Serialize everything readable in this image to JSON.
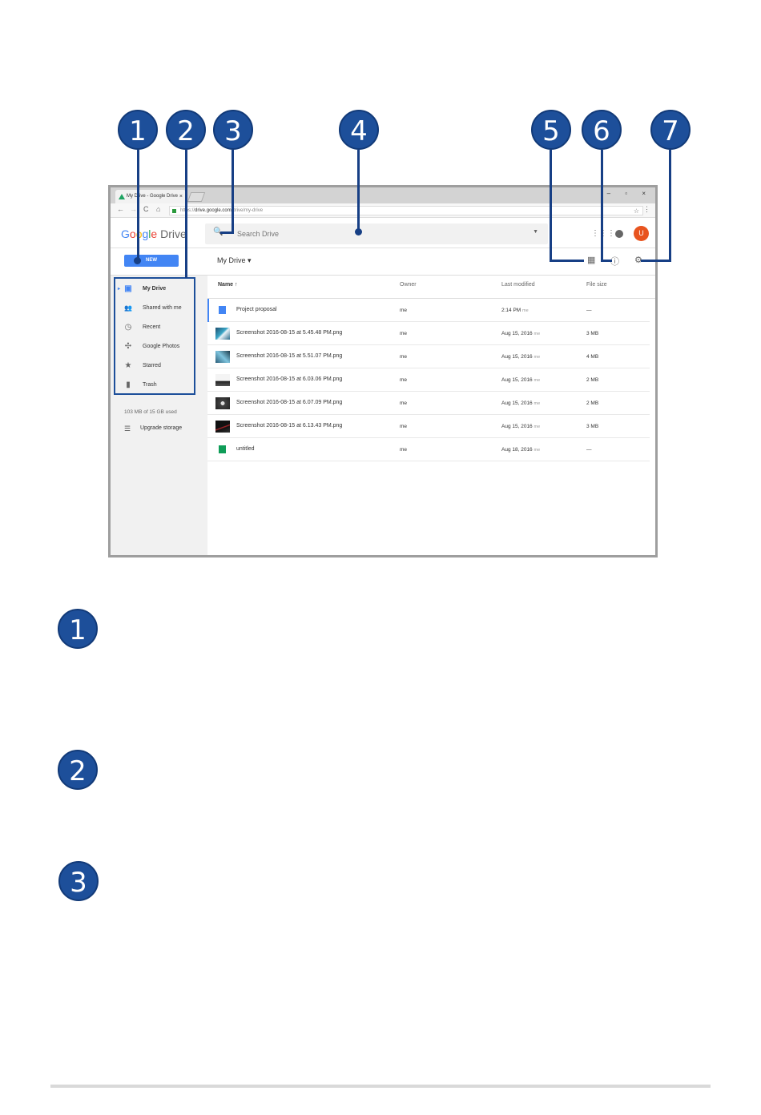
{
  "callouts": [
    "1",
    "2",
    "3",
    "4",
    "5",
    "6",
    "7"
  ],
  "legend": [
    "1",
    "2",
    "3"
  ],
  "browser": {
    "tab_title": "My Drive - Google Drive",
    "tab_close": "×",
    "window_controls": "– ▫ ×",
    "nav_back": "←",
    "nav_forward": "→",
    "nav_reload": "C",
    "nav_home": "⌂",
    "url_prefix": "https://",
    "url_host": "drive.google.com",
    "url_path": "/drive/my-drive",
    "star": "☆",
    "menu": "⋮"
  },
  "drive": {
    "logo_google": [
      "G",
      "o",
      "o",
      "g",
      "l",
      "e"
    ],
    "logo_product": " Drive",
    "search": {
      "icon": "🔍",
      "placeholder": "Search Drive",
      "dropdown": "▼"
    },
    "apps_icon": "⋮⋮⋮",
    "avatar_initial": "U",
    "new_label": "NEW",
    "view_title": "My Drive ▾",
    "grid_icon": "▦",
    "info_icon": "ⓘ",
    "settings_icon": "⚙",
    "sidebar": [
      {
        "label": "My Drive",
        "icon": "▣"
      },
      {
        "label": "Shared with me",
        "icon": "👥"
      },
      {
        "label": "Recent",
        "icon": "◷"
      },
      {
        "label": "Google Photos",
        "icon": "✣"
      },
      {
        "label": "Starred",
        "icon": "★"
      },
      {
        "label": "Trash",
        "icon": "▮"
      }
    ],
    "storage_used": "103 MB of 15 GB used",
    "upgrade_label": "Upgrade storage",
    "upgrade_icon": "☰",
    "columns": {
      "name": "Name ↑",
      "owner": "Owner",
      "modified": "Last modified",
      "size": "File size"
    },
    "files": [
      {
        "name": "Project proposal",
        "owner": "me",
        "modified": "2:14 PM",
        "by": "me",
        "size": "—",
        "type": "doc"
      },
      {
        "name": "Screenshot 2016-08-15 at 5.45.48 PM.png",
        "owner": "me",
        "modified": "Aug 15, 2016",
        "by": "me",
        "size": "3 MB",
        "type": "img1"
      },
      {
        "name": "Screenshot 2016-08-15 at 5.51.07 PM.png",
        "owner": "me",
        "modified": "Aug 15, 2016",
        "by": "me",
        "size": "4 MB",
        "type": "img2"
      },
      {
        "name": "Screenshot 2016-08-15 at 6.03.06 PM.png",
        "owner": "me",
        "modified": "Aug 15, 2016",
        "by": "me",
        "size": "2 MB",
        "type": "img3"
      },
      {
        "name": "Screenshot 2016-08-15 at 6.07.09 PM.png",
        "owner": "me",
        "modified": "Aug 15, 2016",
        "by": "me",
        "size": "2 MB",
        "type": "img4"
      },
      {
        "name": "Screenshot 2016-08-15 at 6.13.43 PM.png",
        "owner": "me",
        "modified": "Aug 15, 2016",
        "by": "me",
        "size": "3 MB",
        "type": "img5"
      },
      {
        "name": "untitled",
        "owner": "me",
        "modified": "Aug 18, 2016",
        "by": "me",
        "size": "—",
        "type": "sheet"
      }
    ]
  }
}
